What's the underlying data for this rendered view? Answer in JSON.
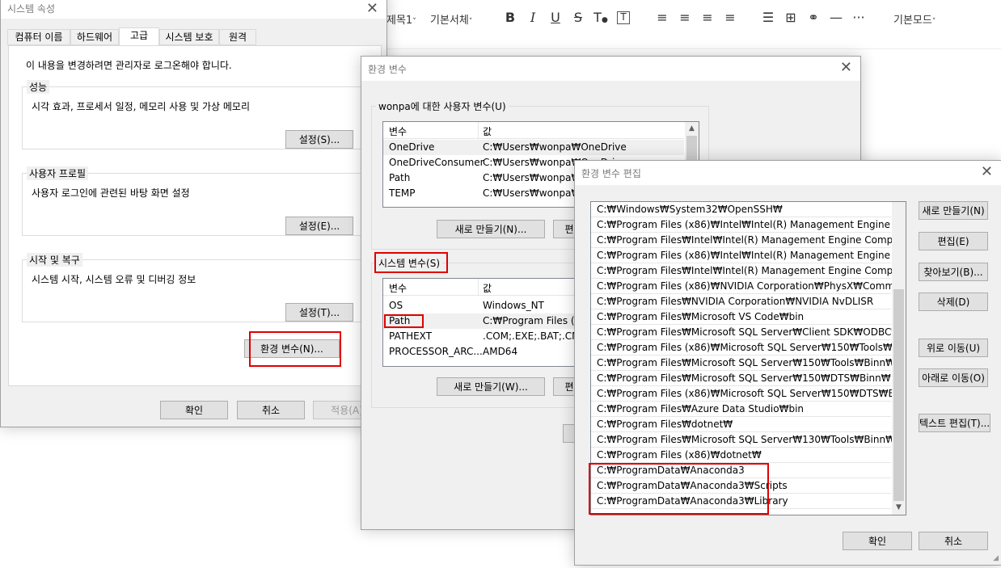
{
  "editor": {
    "heading_select": "제목1",
    "font_select": "기본서체",
    "mode_select": "기본모드"
  },
  "system_properties": {
    "title": "시스템 속성",
    "tabs": [
      "컴퓨터 이름",
      "하드웨어",
      "고급",
      "시스템 보호",
      "원격"
    ],
    "active_tab": "고급",
    "admin_notice": "이 내용을 변경하려면 관리자로 로그온해야 합니다.",
    "performance": {
      "legend": "성능",
      "desc": "시각 효과, 프로세서 일정, 메모리 사용 및 가상 메모리",
      "button": "설정(S)..."
    },
    "user_profile": {
      "legend": "사용자 프로필",
      "desc": "사용자 로그인에 관련된 바탕 화면 설정",
      "button": "설정(E)..."
    },
    "startup_recovery": {
      "legend": "시작 및 복구",
      "desc": "시스템 시작, 시스템 오류 및 디버깅 정보",
      "button": "설정(T)..."
    },
    "env_button": "환경 변수(N)...",
    "ok": "확인",
    "cancel": "취소",
    "apply": "적용(A)"
  },
  "env_vars": {
    "title": "환경 변수",
    "user_legend": "wonpa에 대한 사용자 변수(U)",
    "col_var": "변수",
    "col_val": "값",
    "user_rows": [
      {
        "name": "OneDrive",
        "value": "C:₩Users₩wonpa₩OneDrive"
      },
      {
        "name": "OneDriveConsumer",
        "value": "C:₩Users₩wonpa₩OneDrive"
      },
      {
        "name": "Path",
        "value": "C:₩Users₩wonpa₩AppData"
      },
      {
        "name": "TEMP",
        "value": "C:₩Users₩wonpa₩AppData"
      }
    ],
    "user_new": "새로 만들기(N)...",
    "user_edit": "편",
    "system_legend": "시스템 변수(S)",
    "system_rows": [
      {
        "name": "OS",
        "value": "Windows_NT"
      },
      {
        "name": "Path",
        "value": "C:₩Program Files (x86)"
      },
      {
        "name": "PATHEXT",
        "value": ".COM;.EXE;.BAT;.CMD"
      },
      {
        "name": "PROCESSOR_ARC...",
        "value": "AMD64"
      }
    ],
    "system_new": "새로 만들기(W)...",
    "system_edit": "편"
  },
  "edit_env": {
    "title": "환경 변수 편집",
    "paths": [
      "C:₩Windows₩System32₩OpenSSH₩",
      "C:₩Program Files (x86)₩Intel₩Intel(R) Management Engine Com...",
      "C:₩Program Files₩Intel₩Intel(R) Management Engine Componen...",
      "C:₩Program Files (x86)₩Intel₩Intel(R) Management Engine Com...",
      "C:₩Program Files₩Intel₩Intel(R) Management Engine Componen...",
      "C:₩Program Files (x86)₩NVIDIA Corporation₩PhysX₩Common",
      "C:₩Program Files₩NVIDIA Corporation₩NVIDIA NvDLISR",
      "C:₩Program Files₩Microsoft VS Code₩bin",
      "C:₩Program Files₩Microsoft SQL Server₩Client SDK₩ODBC₩17...",
      "C:₩Program Files (x86)₩Microsoft SQL Server₩150₩Tools₩Binn₩",
      "C:₩Program Files₩Microsoft SQL Server₩150₩Tools₩Binn₩",
      "C:₩Program Files₩Microsoft SQL Server₩150₩DTS₩Binn₩",
      "C:₩Program Files (x86)₩Microsoft SQL Server₩150₩DTS₩Binn₩",
      "C:₩Program Files₩Azure Data Studio₩bin",
      "C:₩Program Files₩dotnet₩",
      "C:₩Program Files₩Microsoft SQL Server₩130₩Tools₩Binn₩",
      "C:₩Program Files (x86)₩dotnet₩",
      "C:₩ProgramData₩Anaconda3",
      "C:₩ProgramData₩Anaconda3₩Scripts",
      "C:₩ProgramData₩Anaconda3₩Library"
    ],
    "btn_new": "새로 만들기(N)",
    "btn_edit": "편집(E)",
    "btn_browse": "찾아보기(B)...",
    "btn_delete": "삭제(D)",
    "btn_up": "위로 이동(U)",
    "btn_down": "아래로 이동(O)",
    "btn_text_edit": "텍스트 편집(T)...",
    "ok": "확인",
    "cancel": "취소"
  },
  "colors": {
    "highlight_red": "#e00000",
    "window_bg": "#f0f0f0",
    "button_bg": "#e1e1e1"
  }
}
